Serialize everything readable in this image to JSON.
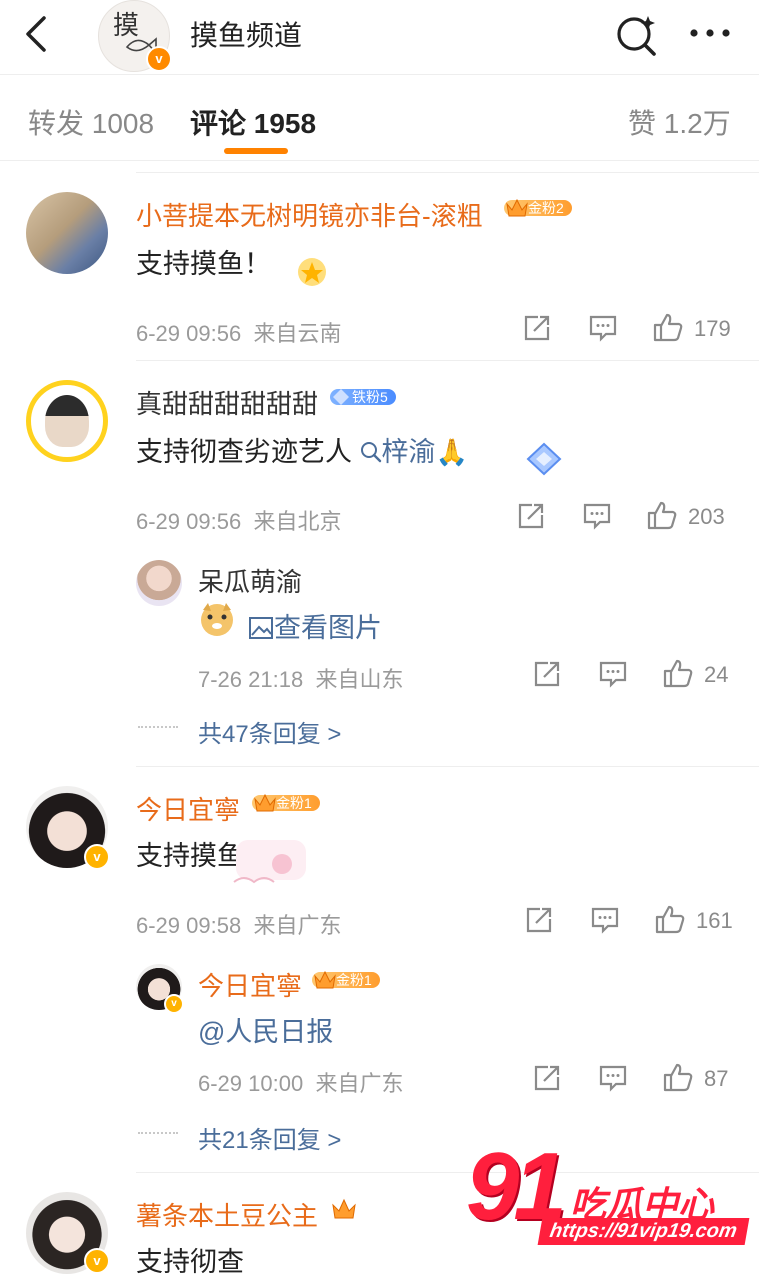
{
  "header": {
    "title": "摸鱼频道",
    "avatar_text": "摸"
  },
  "tabs": {
    "repost": "转发 1008",
    "comment": "评论 1958",
    "like": "赞 1.2万"
  },
  "comments": [
    {
      "name": "小菩提本无树明镜亦非台-滚粗",
      "badge": "金粉2",
      "text": "支持摸鱼！",
      "time": "6-29 09:56",
      "location": "来自云南",
      "likes": "179"
    },
    {
      "name": "真甜甜甜甜甜甜",
      "badge": "铁粉5",
      "text_before": "支持彻查劣迹艺人",
      "topic": "梓渝",
      "emoji": "🙏",
      "time": "6-29 09:56",
      "location": "来自北京",
      "likes": "203",
      "reply": {
        "name": "呆瓜萌渝",
        "image_link": "查看图片",
        "time": "7-26 21:18",
        "location": "来自山东",
        "likes": "24"
      },
      "more_replies": "共47条回复 >"
    },
    {
      "name": "今日宜寧",
      "badge": "金粉1",
      "text": "支持摸鱼",
      "time": "6-29 09:58",
      "location": "来自广东",
      "likes": "161",
      "reply": {
        "name": "今日宜寧",
        "badge": "金粉1",
        "text": "@人民日报",
        "time": "6-29 10:00",
        "location": "来自广东",
        "likes": "87"
      },
      "more_replies": "共21条回复 >"
    },
    {
      "name": "薯条本土豆公主",
      "text": "支持彻查"
    }
  ],
  "watermark": {
    "number": "91",
    "brand": "吃瓜中心",
    "url": "https://91vip19.com"
  },
  "colors": {
    "accent": "#ff8200",
    "name_orange": "#e86b1a",
    "link_blue": "#4a6d9a"
  }
}
